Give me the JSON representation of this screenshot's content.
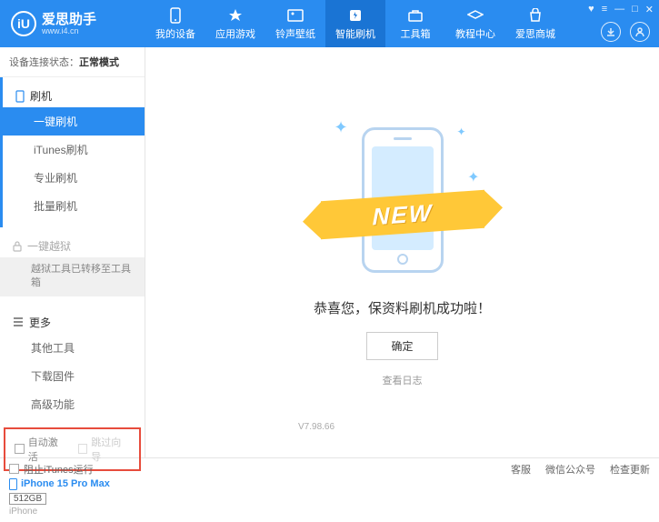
{
  "header": {
    "app_name": "爱思助手",
    "app_url": "www.i4.cn",
    "logo_letter": "iU"
  },
  "nav": [
    {
      "label": "我的设备",
      "icon": "device"
    },
    {
      "label": "应用游戏",
      "icon": "app"
    },
    {
      "label": "铃声壁纸",
      "icon": "ringtone"
    },
    {
      "label": "智能刷机",
      "icon": "flash",
      "active": true
    },
    {
      "label": "工具箱",
      "icon": "toolbox"
    },
    {
      "label": "教程中心",
      "icon": "tutorial"
    },
    {
      "label": "爱思商城",
      "icon": "store"
    }
  ],
  "status": {
    "label": "设备连接状态：",
    "value": "正常模式"
  },
  "sidebar": {
    "flash_header": "刷机",
    "flash_items": [
      "一键刷机",
      "iTunes刷机",
      "专业刷机",
      "批量刷机"
    ],
    "jailbreak_header": "一键越狱",
    "jailbreak_note": "越狱工具已转移至工具箱",
    "more_header": "更多",
    "more_items": [
      "其他工具",
      "下载固件",
      "高级功能"
    ]
  },
  "checkboxes": {
    "auto_activate": "自动激活",
    "skip_setup": "跳过向导"
  },
  "device": {
    "name": "iPhone 15 Pro Max",
    "storage": "512GB",
    "type": "iPhone"
  },
  "main": {
    "ribbon": "NEW",
    "success": "恭喜您，保资料刷机成功啦！",
    "ok": "确定",
    "log": "查看日志"
  },
  "footer": {
    "block_itunes": "阻止iTunes运行",
    "version": "V7.98.66",
    "links": [
      "客服",
      "微信公众号",
      "检查更新"
    ]
  }
}
